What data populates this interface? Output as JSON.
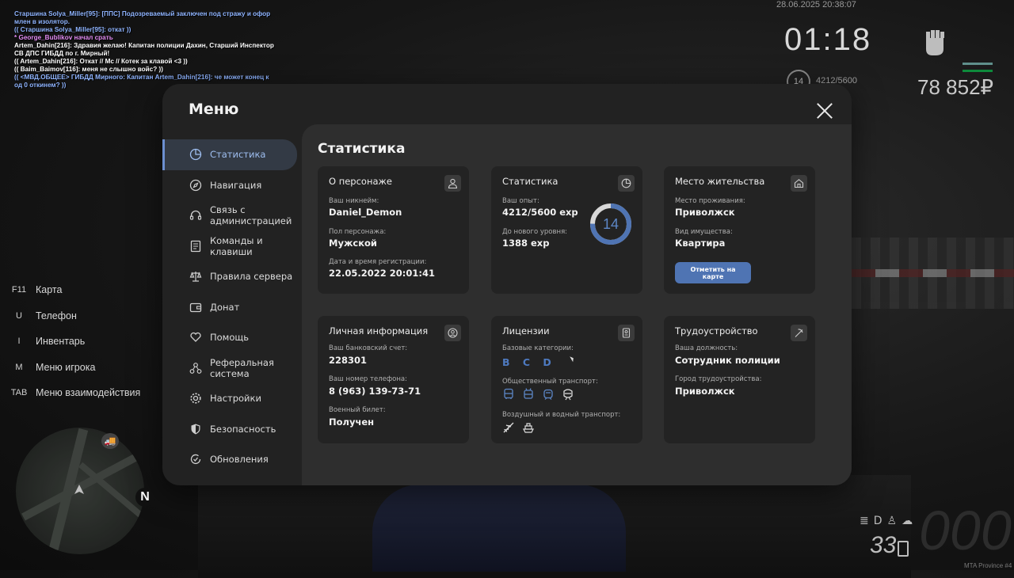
{
  "chat": [
    {
      "text": "Старшина Solya_Miller[95]: [ППС] Подозреваемый заключен под стражу и офор",
      "color": "#8fb4ff"
    },
    {
      "text": "млен в изолятор.",
      "color": "#8fb4ff"
    },
    {
      "text": "(( Старшина Solya_Miller[95]: откат ))",
      "color": "#8fb4ff"
    },
    {
      "text": "* George_Bublikov начал срать",
      "color": "#e28cf2"
    },
    {
      "text": "Artem_Dahin[216]: Здравия желаю! Капитан полиции Дахин, Старший Инспектор",
      "color": "#ffffff"
    },
    {
      "text": " СВ ДПС ГИБДД по г. Мирный!",
      "color": "#ffffff"
    },
    {
      "text": "(( Artem_Dahin[216]: Откат // Мс // Котек за клавой <3 ))",
      "color": "#ffffff"
    },
    {
      "text": "(( Baim_Baimov[116]: меня не слышно войс? ))",
      "color": "#ffffff"
    },
    {
      "text": "(( <МВД.ОБЩЕЕ> ГИБДД Мирного: Капитан Artem_Dahin[216]: че может конец к",
      "color": "#8fb4ff"
    },
    {
      "text": "од 0 откинем? ))",
      "color": "#8fb4ff"
    }
  ],
  "hud": {
    "datetime": "28.06.2025 20:38:07",
    "time": "01:18",
    "level": "14",
    "exp": "4212/5600",
    "money": "78 852₽",
    "fuel": "33",
    "speed": "000",
    "watermark": "MTA Province #4",
    "north": "N"
  },
  "hotkeys": [
    {
      "key": "F11",
      "label": "Карта"
    },
    {
      "key": "U",
      "label": "Телефон"
    },
    {
      "key": "I",
      "label": "Инвентарь"
    },
    {
      "key": "M",
      "label": "Меню игрока"
    },
    {
      "key": "TAB",
      "label": "Меню взаимодействия"
    }
  ],
  "menu": {
    "title": "Меню",
    "sidebar": [
      {
        "label": "Статистика",
        "icon": "pie-chart-icon",
        "active": true
      },
      {
        "label": "Навигация",
        "icon": "compass-icon"
      },
      {
        "label": "Связь с администрацией",
        "icon": "headset-icon"
      },
      {
        "label": "Команды и клавиши",
        "icon": "document-icon"
      },
      {
        "label": "Правила сервера",
        "icon": "scales-icon"
      },
      {
        "label": "Донат",
        "icon": "wallet-icon"
      },
      {
        "label": "Помощь",
        "icon": "heart-hand-icon"
      },
      {
        "label": "Реферальная система",
        "icon": "network-icon"
      },
      {
        "label": "Настройки",
        "icon": "gear-icon"
      },
      {
        "label": "Безопасность",
        "icon": "shield-icon"
      },
      {
        "label": "Обновления",
        "icon": "refresh-check-icon"
      }
    ],
    "content_title": "Статистика",
    "cards": {
      "character": {
        "title": "О персонаже",
        "nickname_label": "Ваш никнейм:",
        "nickname": "Daniel_Demon",
        "gender_label": "Пол персонажа:",
        "gender": "Мужской",
        "reg_label": "Дата и время регистрации:",
        "reg": "22.05.2022 20:01:41"
      },
      "stats": {
        "title": "Статистика",
        "exp_label": "Ваш опыт:",
        "exp": "4212/5600 exp",
        "next_label": "До нового уровня:",
        "next": "1388 exp",
        "level": "14",
        "progress": 0.752
      },
      "residence": {
        "title": "Место жительства",
        "place_label": "Место проживания:",
        "place": "Приволжск",
        "property_label": "Вид имущества:",
        "property": "Квартира",
        "map_button": "Отметить на карте"
      },
      "personal": {
        "title": "Личная информация",
        "bank_label": "Ваш банковский счет:",
        "bank": "228301",
        "phone_label": "Ваш номер телефона:",
        "phone": "8 (963) 139-73-71",
        "military_label": "Военный билет:",
        "military": "Получен"
      },
      "licenses": {
        "title": "Лицензии",
        "base_label": "Базовые категории:",
        "base": "B C D",
        "public_label": "Общественный транспорт:",
        "public_icons": [
          "bus-icon",
          "trolleybus-icon",
          "tram-icon",
          "train-icon"
        ],
        "air_label": "Воздушный и водный транспорт:",
        "air_icons": [
          "airplane-icon",
          "boat-icon"
        ]
      },
      "job": {
        "title": "Трудоустройство",
        "position_label": "Ваша должность:",
        "position": "Сотрудник полиции",
        "city_label": "Город трудоустройства:",
        "city": "Приволжск"
      }
    }
  },
  "colors": {
    "accent": "#4f74b3",
    "active_text": "#9fbff1",
    "license": "#4e7ac0"
  }
}
